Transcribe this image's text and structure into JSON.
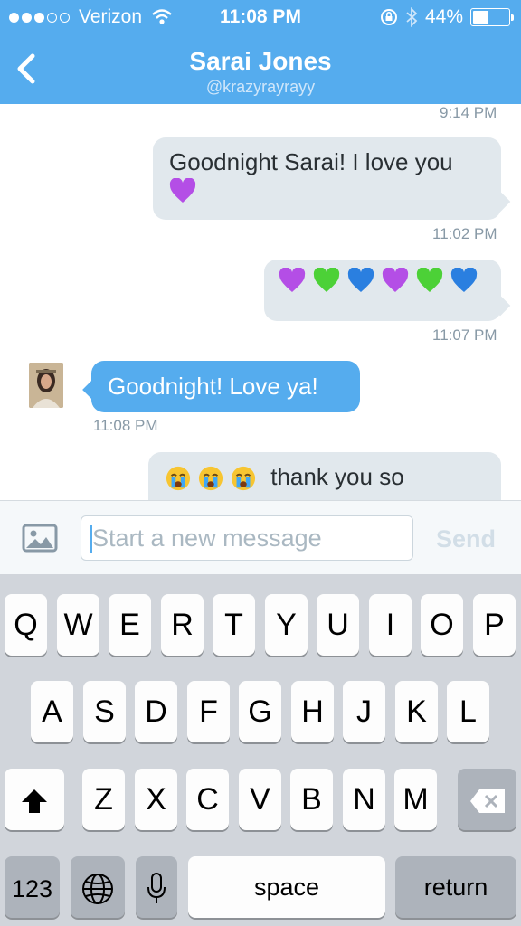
{
  "status_bar": {
    "carrier": "Verizon",
    "time": "11:08 PM",
    "battery_percent": "44%",
    "battery_level": 0.44,
    "signal_bars_filled": 3,
    "signal_bars_total": 5,
    "icons": [
      "wifi-icon",
      "rotation-lock-icon",
      "bluetooth-icon",
      "battery-icon"
    ]
  },
  "header": {
    "title": "Sarai Jones",
    "username": "@krazyrayrayy",
    "back_icon": "chevron-left-icon",
    "background_color": "#55acee"
  },
  "messages": [
    {
      "timestamp": "9:14 PM"
    },
    {
      "direction": "outgoing",
      "text": "Goodnight Sarai! I love you",
      "emoji": [
        "purple-heart"
      ],
      "timestamp": "11:02 PM"
    },
    {
      "direction": "outgoing",
      "text": "",
      "emoji": [
        "purple-heart",
        "green-heart",
        "blue-heart",
        "purple-heart",
        "green-heart",
        "blue-heart"
      ],
      "timestamp": "11:07 PM"
    },
    {
      "direction": "incoming",
      "text": "Goodnight! Love ya!",
      "timestamp": "11:08 PM"
    },
    {
      "direction": "outgoing",
      "text": "thank you so",
      "emoji": [
        "loudly-crying-face",
        "loudly-crying-face",
        "loudly-crying-face"
      ]
    }
  ],
  "composer": {
    "placeholder": "Start a new message",
    "value": "",
    "send_label": "Send",
    "photo_icon": "image-icon"
  },
  "keyboard": {
    "row1": [
      "Q",
      "W",
      "E",
      "R",
      "T",
      "Y",
      "U",
      "I",
      "O",
      "P"
    ],
    "row2": [
      "A",
      "S",
      "D",
      "F",
      "G",
      "H",
      "J",
      "K",
      "L"
    ],
    "row3": [
      "Z",
      "X",
      "C",
      "V",
      "B",
      "N",
      "M"
    ],
    "numbers_label": "123",
    "space_label": "space",
    "return_label": "return"
  },
  "colors": {
    "accent": "#55acee",
    "outgoing_bubble": "#e1e8ed",
    "keyboard_bg": "#d1d5db"
  }
}
